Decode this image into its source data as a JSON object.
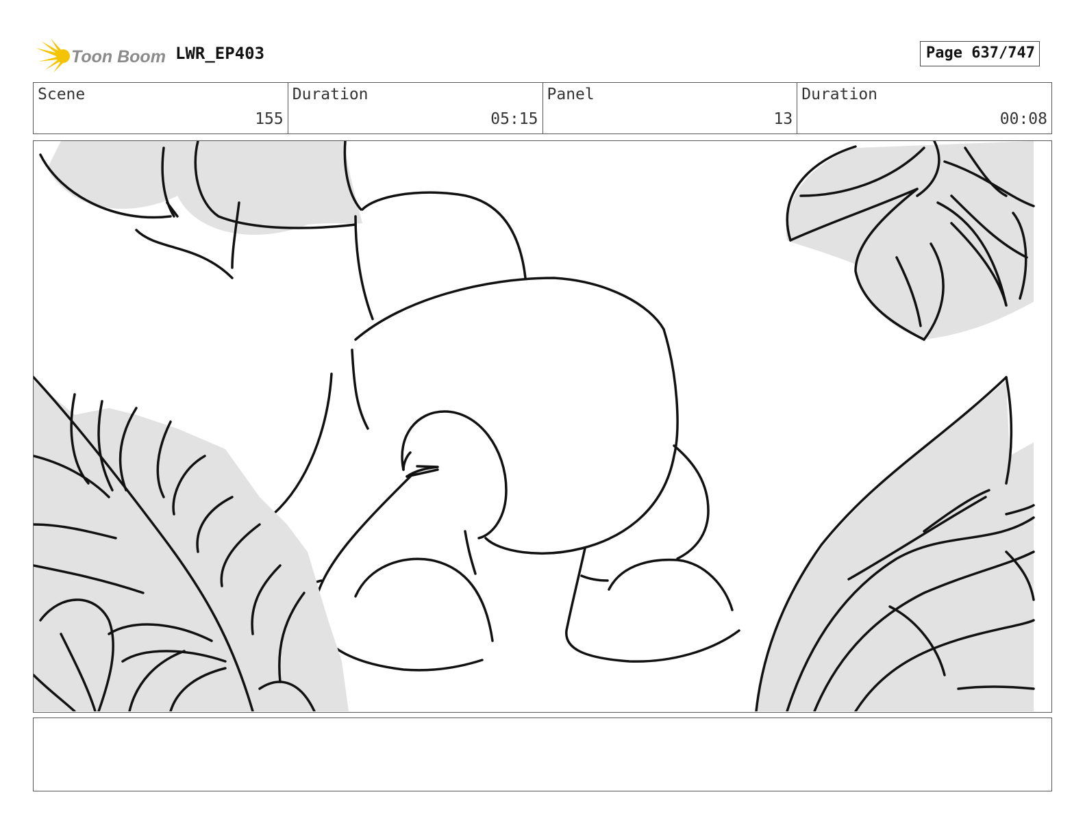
{
  "header": {
    "brand": "Toon Boom",
    "project": "LWR_EP403",
    "page": "Page 637/747"
  },
  "info": {
    "scene_label": "Scene",
    "scene_value": "155",
    "scene_duration_label": "Duration",
    "scene_duration_value": "05:15",
    "panel_label": "Panel",
    "panel_value": "13",
    "panel_duration_label": "Duration",
    "panel_duration_value": "00:08"
  },
  "notes": {
    "text": ""
  },
  "colors": {
    "logo_yellow": "#f5c400",
    "logo_text": "#8a8a8a",
    "ink": "#111111",
    "foliage_fill": "#e2e2e2"
  }
}
